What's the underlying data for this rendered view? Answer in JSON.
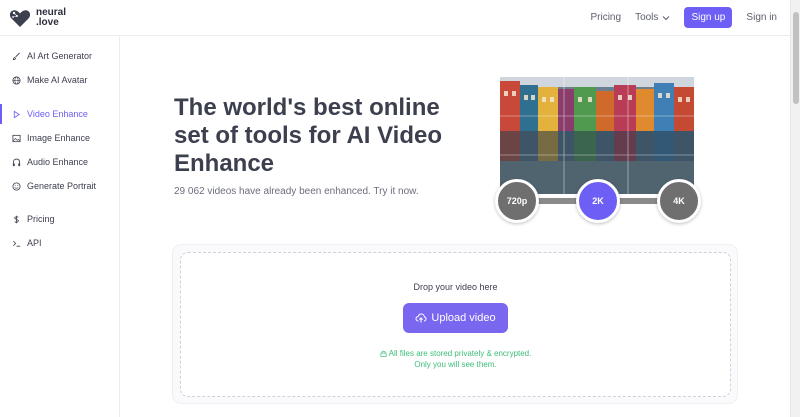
{
  "header": {
    "logo_line1": "neural",
    "logo_line2": ".love",
    "nav_pricing": "Pricing",
    "nav_tools": "Tools",
    "signup": "Sign up",
    "signin": "Sign in",
    "accent_color": "#6d5ef5"
  },
  "sidebar": {
    "items": [
      {
        "label": "AI Art Generator",
        "icon": "brush-icon"
      },
      {
        "label": "Make AI Avatar",
        "icon": "globe-icon"
      },
      {
        "label": "Video Enhance",
        "icon": "play-icon",
        "active": true
      },
      {
        "label": "Image Enhance",
        "icon": "image-icon"
      },
      {
        "label": "Audio Enhance",
        "icon": "headphones-icon"
      },
      {
        "label": "Generate Portrait",
        "icon": "smile-icon"
      },
      {
        "label": "Pricing",
        "icon": "dollar-icon"
      },
      {
        "label": "API",
        "icon": "terminal-icon"
      }
    ]
  },
  "hero": {
    "headline": "The world's best online set of tools for AI Video Enhance",
    "subtext": "29 062 videos have already been enhanced. Try it now.",
    "resolutions": [
      "720p",
      "2K",
      "4K"
    ],
    "selected_resolution": "2K"
  },
  "upload": {
    "drop_label": "Drop your video here",
    "button_label": "Upload video",
    "privacy_line1": "All files are stored privately & encrypted.",
    "privacy_line2": "Only you will see them.",
    "privacy_color": "#3ebd7a"
  }
}
